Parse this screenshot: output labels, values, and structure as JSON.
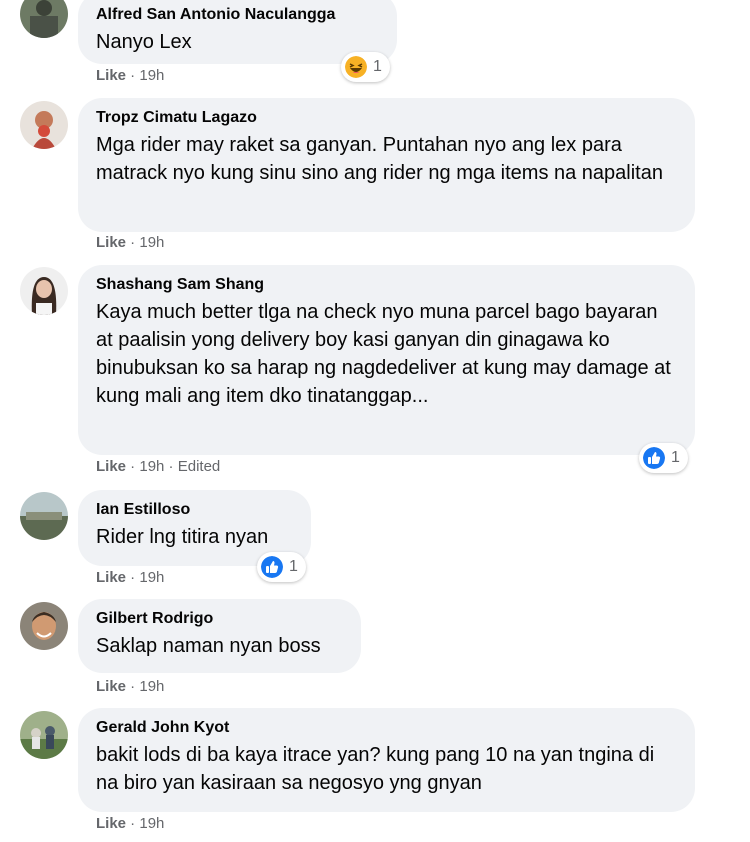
{
  "comments": [
    {
      "author": "Alfred San Antonio Naculangga",
      "text": "Nanyo Lex",
      "action": "Like",
      "time": "19h",
      "edited": "",
      "reaction": {
        "icon": "haha-icon",
        "count": "1"
      }
    },
    {
      "author": "Tropz Cimatu Lagazo",
      "text": "Mga rider may raket sa ganyan. Puntahan nyo ang lex para matrack nyo kung sinu sino ang rider ng mga items na napalitan",
      "action": "Like",
      "time": "19h",
      "edited": "",
      "reaction": null
    },
    {
      "author": "Shashang Sam Shang",
      "text": "Kaya much better tlga na check nyo muna parcel bago bayaran at paalisin yong delivery boy kasi ganyan din ginagawa ko binubuksan ko sa harap ng nagdedeliver at kung may damage at kung mali ang item dko tinatanggap...",
      "action": "Like",
      "time": "19h",
      "edited": "Edited",
      "reaction": {
        "icon": "like-icon",
        "count": "1"
      }
    },
    {
      "author": "Ian Estilloso",
      "text": "Rider lng titira nyan",
      "action": "Like",
      "time": "19h",
      "edited": "",
      "reaction": {
        "icon": "like-icon",
        "count": "1"
      }
    },
    {
      "author": "Gilbert Rodrigo",
      "text": "Saklap naman nyan boss",
      "action": "Like",
      "time": "19h",
      "edited": "",
      "reaction": null
    },
    {
      "author": "Gerald John Kyot",
      "text": "bakit lods di ba kaya itrace yan? kung pang 10 na yan tngina di na biro yan kasiraan sa negosyo yng gnyan",
      "action": "Like",
      "time": "19h",
      "edited": "",
      "reaction": null
    }
  ],
  "colors": {
    "bubble": "#f0f2f5",
    "meta": "#65676b",
    "like_blue": "#1877f2",
    "haha_yellow": "#f7b125"
  }
}
